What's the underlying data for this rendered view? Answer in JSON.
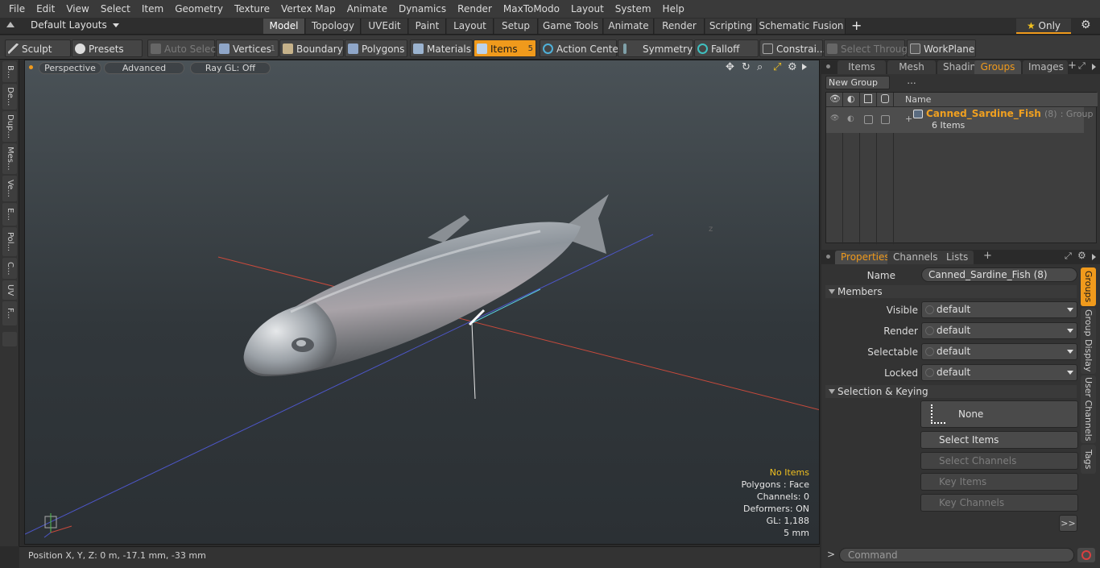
{
  "menu": [
    "File",
    "Edit",
    "View",
    "Select",
    "Item",
    "Geometry",
    "Texture",
    "Vertex Map",
    "Animate",
    "Dynamics",
    "Render",
    "MaxToModo",
    "Layout",
    "System",
    "Help"
  ],
  "layout_bar": {
    "preset": "Default Layouts",
    "tabs": [
      "Model",
      "Topology",
      "UVEdit",
      "Paint",
      "Layout",
      "Setup",
      "Game Tools",
      "Animate",
      "Render",
      "Scripting",
      "Schematic Fusion"
    ],
    "add_label": "+",
    "only_label": "Only"
  },
  "toolbar": {
    "sculpt": "Sculpt",
    "presets": "Presets",
    "auto_select": "Auto Select",
    "vertices": "Vertices",
    "vertices_count": "1",
    "boundary": "Boundary",
    "polygons": "Polygons",
    "materials": "Materials",
    "items": "Items",
    "items_count": "5",
    "action_center": "Action Center",
    "symmetry": "Symmetry",
    "falloff": "Falloff",
    "constraints": "Constrai...",
    "select_through": "Select Through",
    "workplane": "WorkPlane"
  },
  "left_tabs": [
    "B...",
    "De...",
    "Dup...",
    "Mes...",
    "Ve...",
    "E...",
    "Pol...",
    "C...",
    "UV",
    "F..."
  ],
  "viewport": {
    "view_mode": "Perspective",
    "shading": "Advanced",
    "raygl": "Ray GL: Off",
    "hud": {
      "items": "No Items",
      "polygons": "Polygons : Face",
      "channels": "Channels: 0",
      "deformers": "Deformers: ON",
      "gl": "GL: 1,188",
      "scale": "5 mm"
    }
  },
  "status": {
    "position": "Position X, Y, Z:  0 m, -17.1 mm, -33 mm"
  },
  "top_panel": {
    "tabs": [
      "Items",
      "Mesh ...",
      "Shading",
      "Groups",
      "Images"
    ],
    "active_tab": "Groups",
    "add_label": "+",
    "new_group": "New Group",
    "column_name": "Name",
    "group": {
      "name": "Canned_Sardine_Fish",
      "count": "(8)",
      "type": ": Group",
      "items": "6 Items"
    }
  },
  "props_panel": {
    "tabs": [
      "Properties",
      "Channels",
      "Lists"
    ],
    "active_tab": "Properties",
    "add_label": "+",
    "name_label": "Name",
    "name_value": "Canned_Sardine_Fish (8)",
    "members_section": "Members",
    "visible_label": "Visible",
    "visible_value": "default",
    "render_label": "Render",
    "render_value": "default",
    "selectable_label": "Selectable",
    "selectable_value": "default",
    "locked_label": "Locked",
    "locked_value": "default",
    "selection_section": "Selection & Keying",
    "none_button": "None",
    "select_items": "Select Items",
    "select_channels": "Select Channels",
    "key_items": "Key Items",
    "key_channels": "Key Channels",
    "more": ">>",
    "side_tabs": [
      "Groups",
      "Group Display",
      "User Channels",
      "Tags"
    ]
  },
  "command": {
    "prompt": ">",
    "placeholder": "Command"
  },
  "colors": {
    "accent": "#f09a1c",
    "group_name": "#f0a020",
    "hud_warning": "#f0c020"
  }
}
